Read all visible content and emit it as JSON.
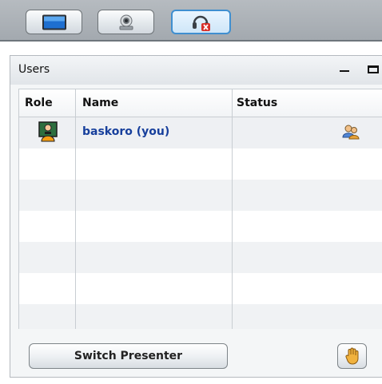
{
  "toolbar": {
    "buttons": [
      {
        "name": "presentation-window-button",
        "icon": "monitor-icon"
      },
      {
        "name": "webcam-button",
        "icon": "webcam-icon"
      },
      {
        "name": "audio-disabled-button",
        "icon": "headset-muted-icon",
        "active": true
      }
    ]
  },
  "users_panel": {
    "title": "Users",
    "columns": {
      "role": "Role",
      "name": "Name",
      "status": "Status"
    },
    "rows": [
      {
        "role_icon": "presenter-icon",
        "name": "baskoro (you)",
        "status_icon": "users-status-icon"
      }
    ],
    "switch_presenter_label": "Switch Presenter",
    "raise_hand_icon": "raise-hand-icon"
  },
  "colors": {
    "accent": "#3f8fd0",
    "name_text": "#173f9c",
    "toolbar_bg": "#a3a9af"
  }
}
